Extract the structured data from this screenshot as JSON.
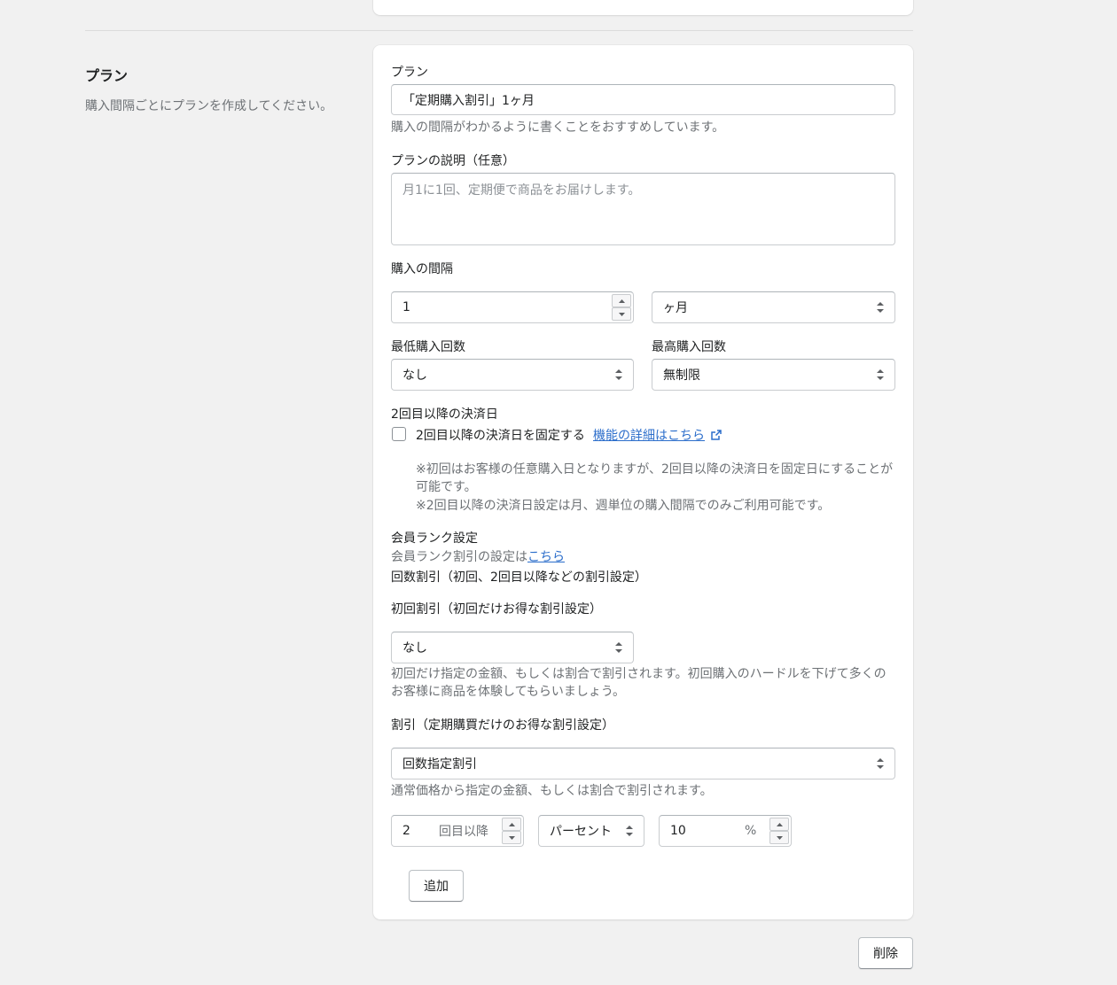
{
  "section": {
    "title": "プラン",
    "description": "購入間隔ごとにプランを作成してください。"
  },
  "plan": {
    "name_label": "プラン",
    "name_value": "「定期購入割引」1ヶ月",
    "name_help": "購入の間隔がわかるように書くことをおすすめしています。",
    "desc_label": "プランの説明（任意）",
    "desc_placeholder": "月1に1回、定期便で商品をお届けします。",
    "interval_label": "購入の間隔",
    "interval_value": "1",
    "interval_unit": "ヶ月",
    "min_label": "最低購入回数",
    "min_value": "なし",
    "max_label": "最高購入回数",
    "max_value": "無制限",
    "payment_label": "2回目以降の決済日",
    "payment_checkbox_label": "2回目以降の決済日を固定する",
    "payment_detail_link": "機能の詳細はこちら",
    "payment_note_1": "※初回はお客様の任意購入日となりますが、2回目以降の決済日を固定日にすることが可能です。",
    "payment_note_2": "※2回目以降の決済日設定は月、週単位の購入間隔でのみご利用可能です。",
    "member_label": "会員ランク設定",
    "member_text": "会員ランク割引の設定は",
    "member_link": "こちら",
    "count_discount_label": "回数割引（初回、2回目以降などの割引設定）",
    "first_discount_label": "初回割引（初回だけお得な割引設定）",
    "first_discount_value": "なし",
    "first_discount_help": "初回だけ指定の金額、もしくは割合で割引されます。初回購入のハードルを下げて多くのお客様に商品を体験してもらいましょう。",
    "discount_label": "割引（定期購買だけのお得な割引設定）",
    "discount_value": "回数指定割引",
    "discount_help": "通常価格から指定の金額、もしくは割合で割引されます。",
    "times_value": "2",
    "times_suffix": "回目以降",
    "type_value": "パーセント",
    "rate_value": "10",
    "rate_suffix": "%",
    "add_button": "追加",
    "delete_button": "削除"
  }
}
